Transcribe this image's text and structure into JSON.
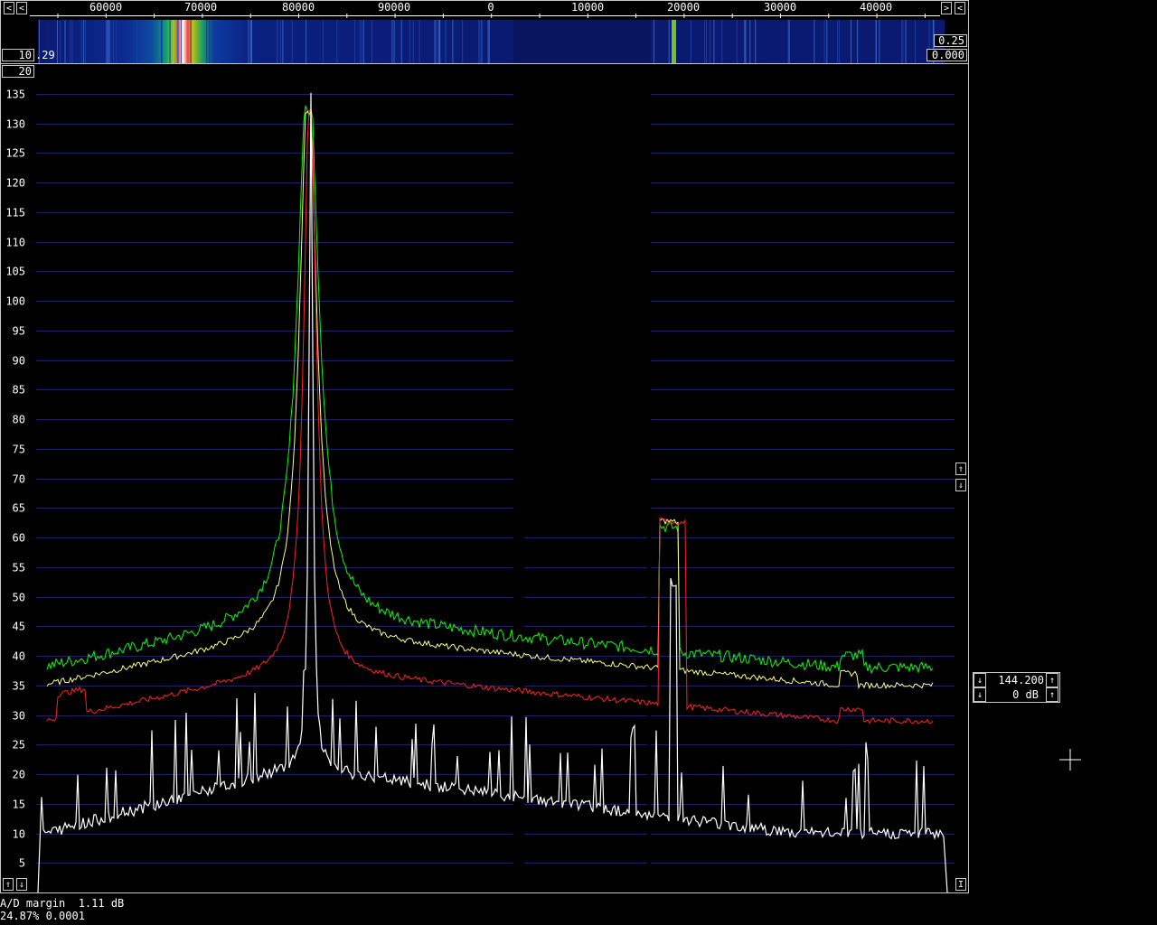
{
  "top_axis": {
    "ticks": [
      {
        "label": "60000"
      },
      {
        "label": "70000"
      },
      {
        "label": "80000"
      },
      {
        "label": "90000"
      },
      {
        "label": "0"
      },
      {
        "label": "10000"
      },
      {
        "label": "20000"
      },
      {
        "label": "30000"
      },
      {
        "label": "40000"
      }
    ]
  },
  "controls": {
    "left_arrow": "<",
    "right_arrow": ">",
    "waterfall_gain": "0.25",
    "waterfall_zero": "0.000",
    "waterfall_avg": "10",
    "waterfall_avg_suffix": ".29",
    "spectrum_avg": "20",
    "freq_display": "144.200",
    "gain_display": "0 dB",
    "up_arrow": "⇑",
    "down_arrow": "⇓",
    "up_small": "↑",
    "down_small": "↓",
    "bottom_right": "I"
  },
  "status": {
    "ad_margin": "A/D margin  1.11 dB",
    "line2": "24.87% 0.0001"
  },
  "chart_data": {
    "type": "line",
    "ylabels": [
      "135",
      "130",
      "125",
      "120",
      "115",
      "110",
      "105",
      "100",
      "95",
      "90",
      "85",
      "80",
      "75",
      "70",
      "65",
      "60",
      "55",
      "50",
      "45",
      "40",
      "35",
      "30",
      "25",
      "20",
      "15",
      "10",
      "5"
    ],
    "ylim": [
      0,
      137
    ],
    "colors": {
      "green": "#00ff00",
      "yellow": "#ffff80",
      "red": "#ff2020",
      "white": "#ffffff",
      "grid": "#1818a0"
    }
  }
}
